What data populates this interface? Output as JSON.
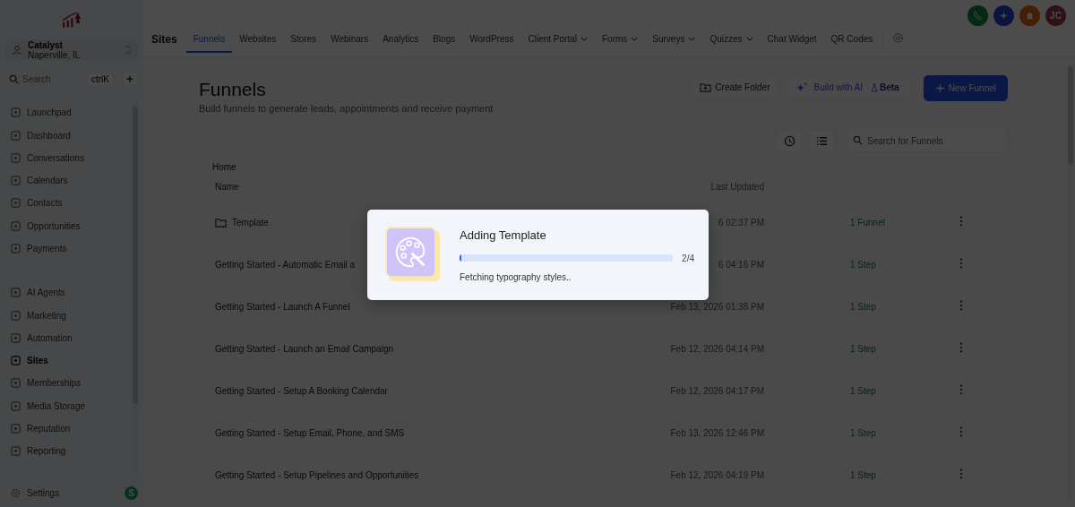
{
  "sidebar": {
    "account": {
      "name": "Catalyst",
      "location": "Naperville, IL"
    },
    "search": {
      "placeholder": "Search",
      "shortcut": "ctrlK",
      "add": "+"
    },
    "groups": [
      [
        {
          "label": "Launchpad",
          "selected": false
        },
        {
          "label": "Dashboard",
          "selected": false
        },
        {
          "label": "Conversations",
          "selected": false
        },
        {
          "label": "Calendars",
          "selected": false
        },
        {
          "label": "Contacts",
          "selected": false
        },
        {
          "label": "Opportunities",
          "selected": false
        },
        {
          "label": "Payments",
          "selected": false
        }
      ],
      [
        {
          "label": "AI Agents",
          "selected": false
        },
        {
          "label": "Marketing",
          "selected": false
        },
        {
          "label": "Automation",
          "selected": false
        },
        {
          "label": "Sites",
          "selected": true
        },
        {
          "label": "Memberships",
          "selected": false
        },
        {
          "label": "Media Storage",
          "selected": false
        },
        {
          "label": "Reputation",
          "selected": false
        },
        {
          "label": "Reporting",
          "selected": false
        }
      ]
    ],
    "settings": {
      "label": "Settings",
      "badge": "S"
    }
  },
  "header": {
    "avatar": "JC",
    "section": "Sites",
    "tabs": [
      {
        "label": "Funnels",
        "selected": true,
        "dropdown": false
      },
      {
        "label": "Websites",
        "selected": false,
        "dropdown": false
      },
      {
        "label": "Stores",
        "selected": false,
        "dropdown": false
      },
      {
        "label": "Webinars",
        "selected": false,
        "dropdown": false
      },
      {
        "label": "Analytics",
        "selected": false,
        "dropdown": false
      },
      {
        "label": "Blogs",
        "selected": false,
        "dropdown": false
      },
      {
        "label": "WordPress",
        "selected": false,
        "dropdown": false
      },
      {
        "label": "Client Portal",
        "selected": false,
        "dropdown": true
      },
      {
        "label": "Forms",
        "selected": false,
        "dropdown": true
      },
      {
        "label": "Surveys",
        "selected": false,
        "dropdown": true
      },
      {
        "label": "Quizzes",
        "selected": false,
        "dropdown": true
      },
      {
        "label": "Chat Widget",
        "selected": false,
        "dropdown": false
      },
      {
        "label": "QR Codes",
        "selected": false,
        "dropdown": false
      }
    ]
  },
  "page": {
    "title": "Funnels",
    "subtitle": "Build funnels to generate leads, appointments and receive payment",
    "buttons": {
      "create_folder": "Create Folder",
      "build_ai": "Build with AI",
      "beta": "Beta",
      "new_funnel": "New Funnel"
    },
    "search": {
      "placeholder": "Search for Funnels"
    },
    "breadcrumb": "Home",
    "columns": [
      "Name",
      "Last Updated"
    ],
    "rows": [
      {
        "kind": "folder",
        "name": "Template",
        "updated": "6 02:37 PM",
        "count": "1 Funnel"
      },
      {
        "kind": "funnel",
        "name": "Getting Started - Automatic Email a",
        "updated": "6 04:16 PM",
        "count": "1 Step"
      },
      {
        "kind": "funnel",
        "name": "Getting Started - Launch A Funnel",
        "updated": "Feb 13, 2026 01:38 PM",
        "count": "1 Step"
      },
      {
        "kind": "funnel",
        "name": "Getting Started - Launch an Email Campaign",
        "updated": "Feb 12, 2026 04:14 PM",
        "count": "1 Step"
      },
      {
        "kind": "funnel",
        "name": "Getting Started - Setup A Booking Calendar",
        "updated": "Feb 12, 2026 04:17 PM",
        "count": "1 Step"
      },
      {
        "kind": "funnel",
        "name": "Getting Started - Setup Email, Phone, and SMS",
        "updated": "Feb 13, 2026 12:46 PM",
        "count": "1 Step"
      },
      {
        "kind": "funnel",
        "name": "Getting Started - Setup Pipelines and Opportunities",
        "updated": "Feb 12, 2026 04:19 PM",
        "count": "1 Step"
      }
    ]
  },
  "modal": {
    "title": "Adding Template",
    "level": 0.01,
    "progress": "2/4",
    "status": "Fetching typography styles.."
  }
}
